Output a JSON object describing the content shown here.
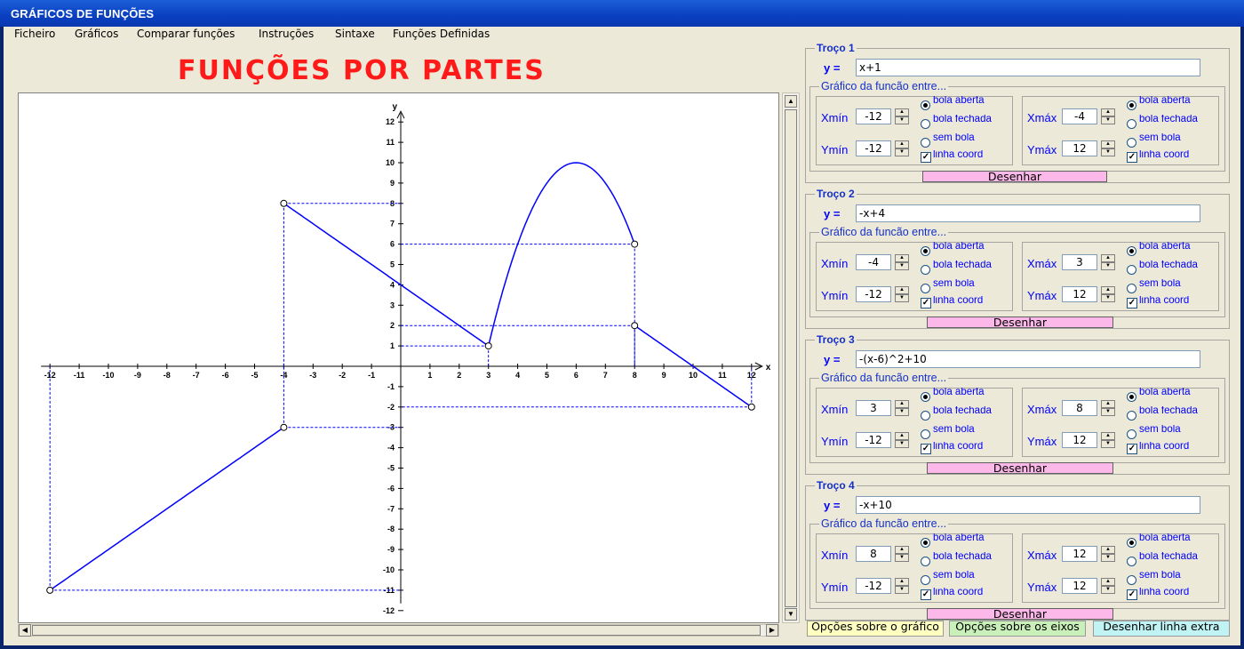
{
  "window": {
    "title": "GRÁFICOS DE FUNÇÕES"
  },
  "menu": [
    "Ficheiro",
    "Gráficos",
    "Comparar funções",
    "Instruções",
    "Sintaxe",
    "Funções Definidas"
  ],
  "heading": "FUNÇÕES POR PARTES",
  "colors": {
    "graph_line": "#0000ff",
    "heading": "#ff1a1a",
    "draw_button": "#fcb8e8"
  },
  "chart_data": {
    "type": "line",
    "xlabel": "x",
    "ylabel": "y",
    "xlim": [
      -12,
      12
    ],
    "ylim": [
      -12,
      12
    ],
    "x_ticks": [
      "-12",
      "-11",
      "-10",
      "-9",
      "-8",
      "-7",
      "-6",
      "-5",
      "-4",
      "-3",
      "-2",
      "-1",
      "1",
      "2",
      "3",
      "4",
      "5",
      "6",
      "7",
      "8",
      "9",
      "10",
      "11",
      "12"
    ],
    "y_ticks": [
      "12",
      "11",
      "10",
      "9",
      "8",
      "7",
      "6",
      "5",
      "4",
      "3",
      "2",
      "1",
      "-1",
      "-2",
      "-3",
      "-4",
      "-5",
      "-6",
      "-7",
      "-8",
      "-9",
      "-10",
      "-11",
      "-12"
    ],
    "series": [
      {
        "expr": "x+1",
        "xrange": [
          -12,
          -4
        ],
        "points": [
          [
            -12,
            -11
          ],
          [
            -4,
            -3
          ]
        ]
      },
      {
        "expr": "-x+4",
        "xrange": [
          -4,
          3
        ],
        "points": [
          [
            -4,
            8
          ],
          [
            3,
            1
          ]
        ]
      },
      {
        "expr": "-(x-6)^2+10",
        "xrange": [
          3,
          8
        ],
        "peak": [
          6,
          10
        ]
      },
      {
        "expr": "-x+10",
        "xrange": [
          8,
          12
        ],
        "points": [
          [
            8,
            2
          ],
          [
            12,
            -2
          ]
        ]
      }
    ],
    "endpoint_circles": [
      [
        -12,
        -11
      ],
      [
        -4,
        -3
      ],
      [
        -4,
        8
      ],
      [
        3,
        1
      ],
      [
        8,
        6
      ],
      [
        8,
        2
      ],
      [
        12,
        -2
      ]
    ],
    "grid": false
  },
  "option_labels": {
    "aberta": "bola aberta",
    "fechada": "bola fechada",
    "sem": "sem bola",
    "coord": "linha coord"
  },
  "panels": [
    {
      "title": "Troço 1",
      "y_label": "y =",
      "expr": "x+1",
      "subtitle": "Gráfico da funcão entre...",
      "xmin_label": "Xmín",
      "ymin_label": "Ymín",
      "xmax_label": "Xmáx",
      "ymax_label": "Ymáx",
      "xmin": "-12",
      "ymin": "-12",
      "xmax": "-4",
      "ymax": "12",
      "button": "Desenhar"
    },
    {
      "title": "Troço 2",
      "y_label": "y =",
      "expr": "-x+4",
      "subtitle": "Gráfico da funcão entre...",
      "xmin_label": "Xmín",
      "ymin_label": "Ymín",
      "xmax_label": "Xmáx",
      "ymax_label": "Ymáx",
      "xmin": "-4",
      "ymin": "-12",
      "xmax": "3",
      "ymax": "12",
      "button": "Desenhar"
    },
    {
      "title": "Troço 3",
      "y_label": "y =",
      "expr": "-(x-6)^2+10",
      "subtitle": "Gráfico da funcão entre...",
      "xmin_label": "Xmín",
      "ymin_label": "Ymín",
      "xmax_label": "Xmáx",
      "ymax_label": "Ymáx",
      "xmin": "3",
      "ymin": "-12",
      "xmax": "8",
      "ymax": "12",
      "button": "Desenhar"
    },
    {
      "title": "Troço 4",
      "y_label": "y =",
      "expr": "-x+10",
      "subtitle": "Gráfico da funcão entre...",
      "xmin_label": "Xmín",
      "ymin_label": "Ymín",
      "xmax_label": "Xmáx",
      "ymax_label": "Ymáx",
      "xmin": "8",
      "ymin": "-12",
      "xmax": "12",
      "ymax": "12",
      "button": "Desenhar"
    }
  ],
  "bottom_buttons": [
    {
      "label": "Opções sobre o gráfico",
      "color": "#ffffc0"
    },
    {
      "label": "Opções sobre os eixos",
      "color": "#c8f0b8"
    },
    {
      "label": "Desenhar linha extra",
      "color": "#c0f4f4"
    }
  ]
}
